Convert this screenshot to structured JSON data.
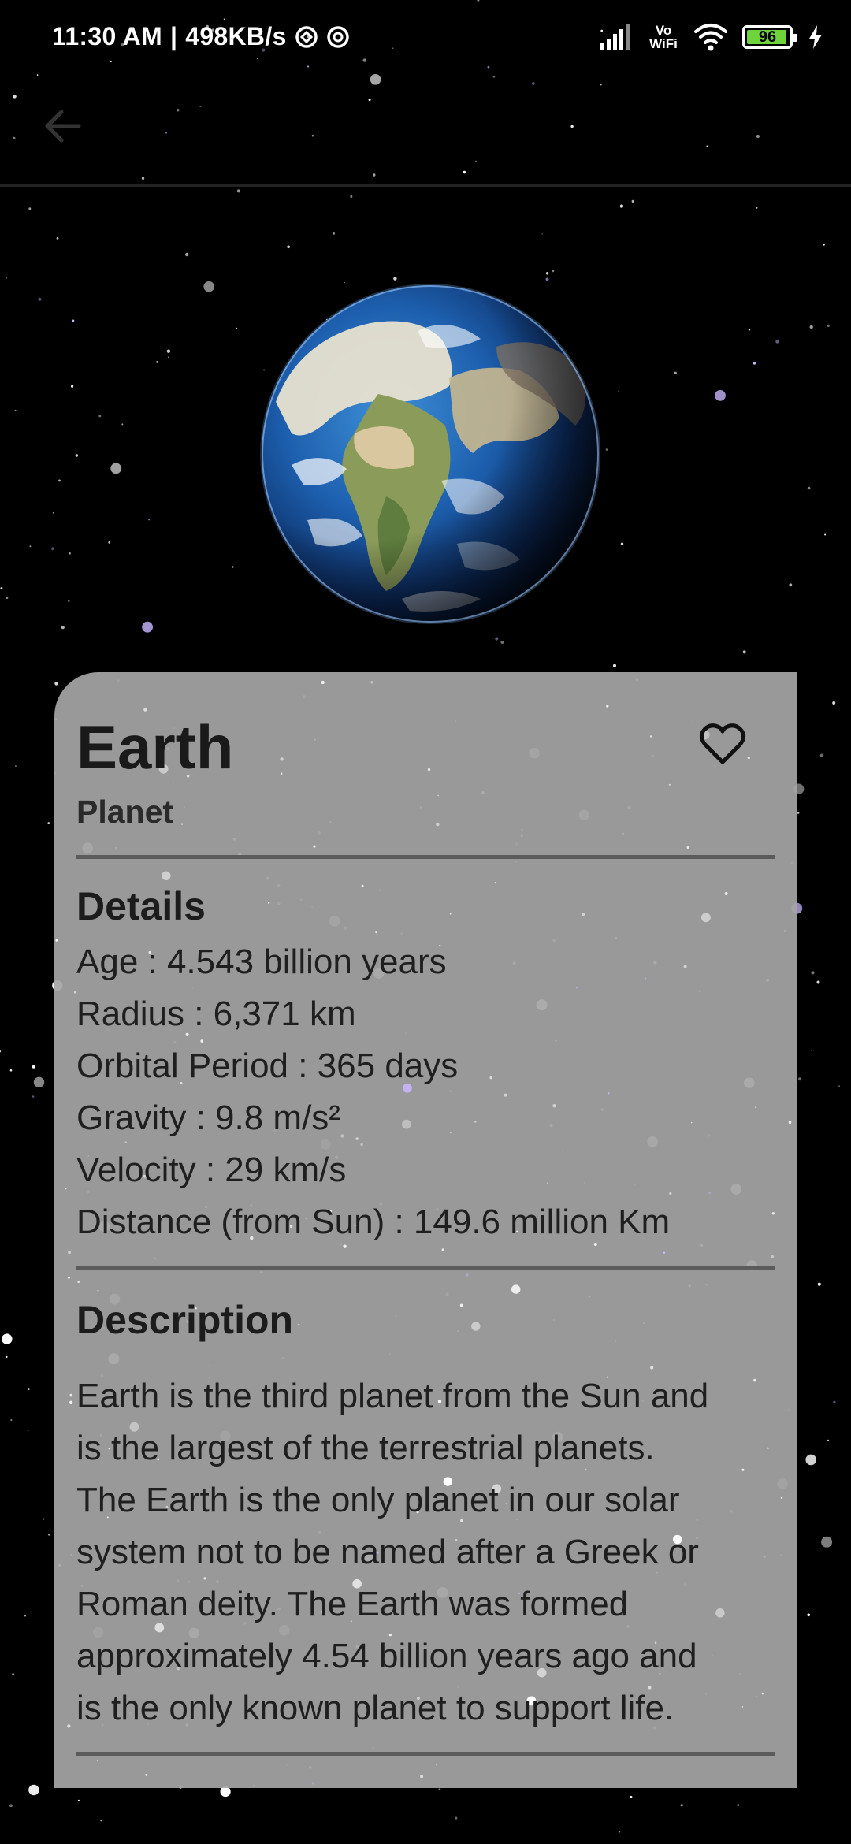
{
  "status_bar": {
    "time": "11:30 AM",
    "separator": "|",
    "speed": "498KB/s",
    "network_label_top": "Vo",
    "network_label_bottom": "WiFi",
    "battery": "96",
    "battery_level": 0.96,
    "icons": [
      "notification-circle-icon",
      "notification-circle-icon",
      "signal-icon",
      "wifi-icon",
      "battery-icon",
      "charging-bolt-icon"
    ]
  },
  "app_bar": {
    "back_icon": "arrow-left-icon"
  },
  "planet": {
    "name": "Earth",
    "type": "Planet",
    "favorite_icon": "heart-outline-icon",
    "details_title": "Details",
    "details": [
      "Age : 4.543 billion years",
      "Radius : 6,371 km",
      "Orbital Period : 365 days",
      "Gravity : 9.8 m/s²",
      "Velocity : 29 km/s",
      "Distance (from Sun) : 149.6 million Km"
    ],
    "description_title": "Description",
    "description_lines": [
      "Earth is the third planet from the Sun and",
      "is the largest of the terrestrial planets.",
      "The Earth is the only planet in our solar",
      "system not to be named after a Greek or",
      "Roman deity. The Earth was formed",
      "approximately 4.54 billion years ago and",
      "is the only known planet to support life."
    ]
  },
  "colors": {
    "background": "#000000",
    "card": "#a5a5a5",
    "text": "#1c1c1c",
    "divider": "#5b5b5b",
    "battery": "#6fd43b"
  }
}
